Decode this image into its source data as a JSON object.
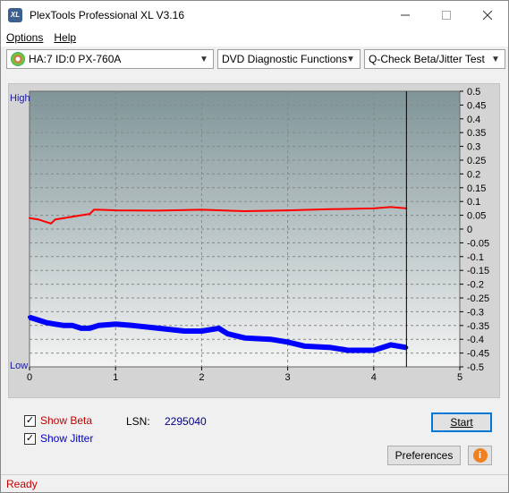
{
  "window": {
    "title": "PlexTools Professional XL V3.16",
    "icon_label": "XL",
    "minimize_icon": "minimize-icon",
    "maximize_icon": "maximize-icon",
    "close_icon": "close-icon"
  },
  "menu": {
    "options_label": "Options",
    "help_label": "Help"
  },
  "toolbar": {
    "drive_select": "HA:7 ID:0  PX-760A",
    "function_select": "DVD Diagnostic Functions",
    "test_select": "Q-Check Beta/Jitter Test"
  },
  "chart": {
    "high_label": "High",
    "low_label": "Low",
    "x_ticks": [
      "0",
      "1",
      "2",
      "3",
      "4",
      "5"
    ],
    "y_ticks": [
      "0.5",
      "0.45",
      "0.4",
      "0.35",
      "0.3",
      "0.25",
      "0.2",
      "0.15",
      "0.1",
      "0.05",
      "0",
      "-0.05",
      "-0.1",
      "-0.15",
      "-0.2",
      "-0.25",
      "-0.3",
      "-0.35",
      "-0.4",
      "-0.45",
      "-0.5"
    ],
    "colors": {
      "beta": "#ff0000",
      "jitter": "#0000ff",
      "grid": "#808080",
      "bg_top": "#7f9598",
      "bg_bottom": "#f2f2f2"
    }
  },
  "chart_data": {
    "type": "line",
    "xlim": [
      0,
      5
    ],
    "ylim": [
      -0.5,
      0.5
    ],
    "marker_x": 4.38,
    "series": [
      {
        "name": "Beta",
        "x": [
          0,
          0.1,
          0.2,
          0.25,
          0.3,
          0.4,
          0.5,
          0.6,
          0.7,
          0.75,
          0.8,
          1.0,
          1.5,
          2.0,
          2.5,
          3.0,
          3.5,
          4.0,
          4.2,
          4.38
        ],
        "values": [
          0.04,
          0.035,
          0.025,
          0.02,
          0.035,
          0.04,
          0.045,
          0.05,
          0.055,
          0.07,
          0.07,
          0.068,
          0.067,
          0.07,
          0.065,
          0.068,
          0.072,
          0.075,
          0.08,
          0.075
        ]
      },
      {
        "name": "Jitter",
        "x": [
          0,
          0.1,
          0.2,
          0.3,
          0.4,
          0.5,
          0.6,
          0.7,
          0.8,
          1.0,
          1.2,
          1.5,
          1.8,
          2.0,
          2.2,
          2.3,
          2.5,
          2.8,
          3.0,
          3.2,
          3.5,
          3.7,
          4.0,
          4.2,
          4.38
        ],
        "values": [
          -0.32,
          -0.33,
          -0.34,
          -0.345,
          -0.35,
          -0.35,
          -0.36,
          -0.36,
          -0.35,
          -0.345,
          -0.35,
          -0.36,
          -0.37,
          -0.37,
          -0.36,
          -0.38,
          -0.395,
          -0.4,
          -0.41,
          -0.425,
          -0.43,
          -0.44,
          -0.44,
          -0.42,
          -0.43
        ]
      }
    ]
  },
  "bottom": {
    "show_beta_label": "Show Beta",
    "show_jitter_label": "Show Jitter",
    "lsn_label": "LSN:",
    "lsn_value": "2295040",
    "start_label": "Start",
    "preferences_label": "Preferences",
    "info_icon": "info-icon"
  },
  "status": {
    "text": "Ready"
  }
}
